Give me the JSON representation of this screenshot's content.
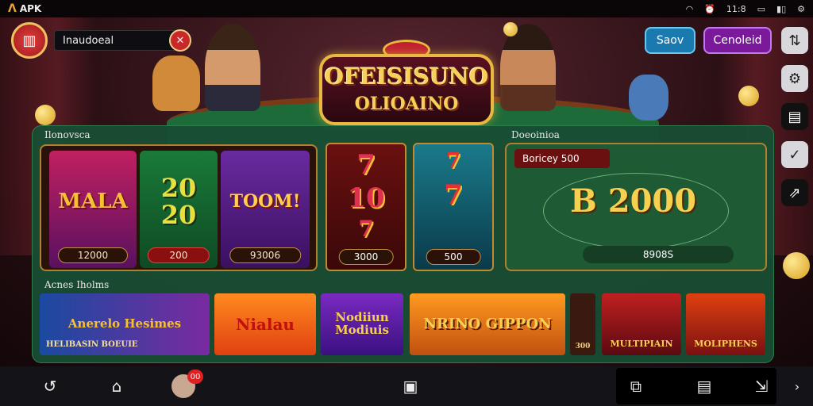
{
  "status_bar": {
    "app_label": "APK",
    "clock": "11:8"
  },
  "profile": {
    "username": "Inaudoeal"
  },
  "header_buttons": {
    "save": "Saov",
    "cancel": "Cenoleid"
  },
  "logo": {
    "line1": "OFEISISUNO",
    "line2": "OLIOAINO"
  },
  "sections": {
    "slots_title": "Ilonovsca",
    "bonus_title": "Doeoinioa",
    "games_title": "Acnes Iholms"
  },
  "slot_cards": [
    {
      "art": "MALA",
      "value": "12000"
    },
    {
      "art": "20\n20",
      "value": "200"
    },
    {
      "art": "TOOM!",
      "value": "93006"
    }
  ],
  "reels": [
    {
      "symbols": [
        "7",
        "10",
        "7"
      ],
      "value": "3000"
    },
    {
      "symbols": [
        "7",
        "7"
      ],
      "value": "500"
    }
  ],
  "bonus": {
    "tag": "Boricey 500",
    "amount": "B 2000",
    "bottom": "8908S"
  },
  "games": [
    {
      "title": "Anerelo Hesimes",
      "caption": "HELIBASIN BOEUIE"
    },
    {
      "title": "Nialau"
    },
    {
      "title": "Nodiiun Modiuis"
    },
    {
      "title": "NRINO GIPPON"
    },
    {
      "title": "300"
    },
    {
      "title": "MULTIPIAIN"
    },
    {
      "title": "MOLIPHENS"
    }
  ],
  "nav": {
    "notif_count": "00"
  },
  "colors": {
    "felt": "#1e6b3a",
    "gold": "#f6d050",
    "save": "#1a7ab0",
    "cancel": "#7a1a9a"
  }
}
